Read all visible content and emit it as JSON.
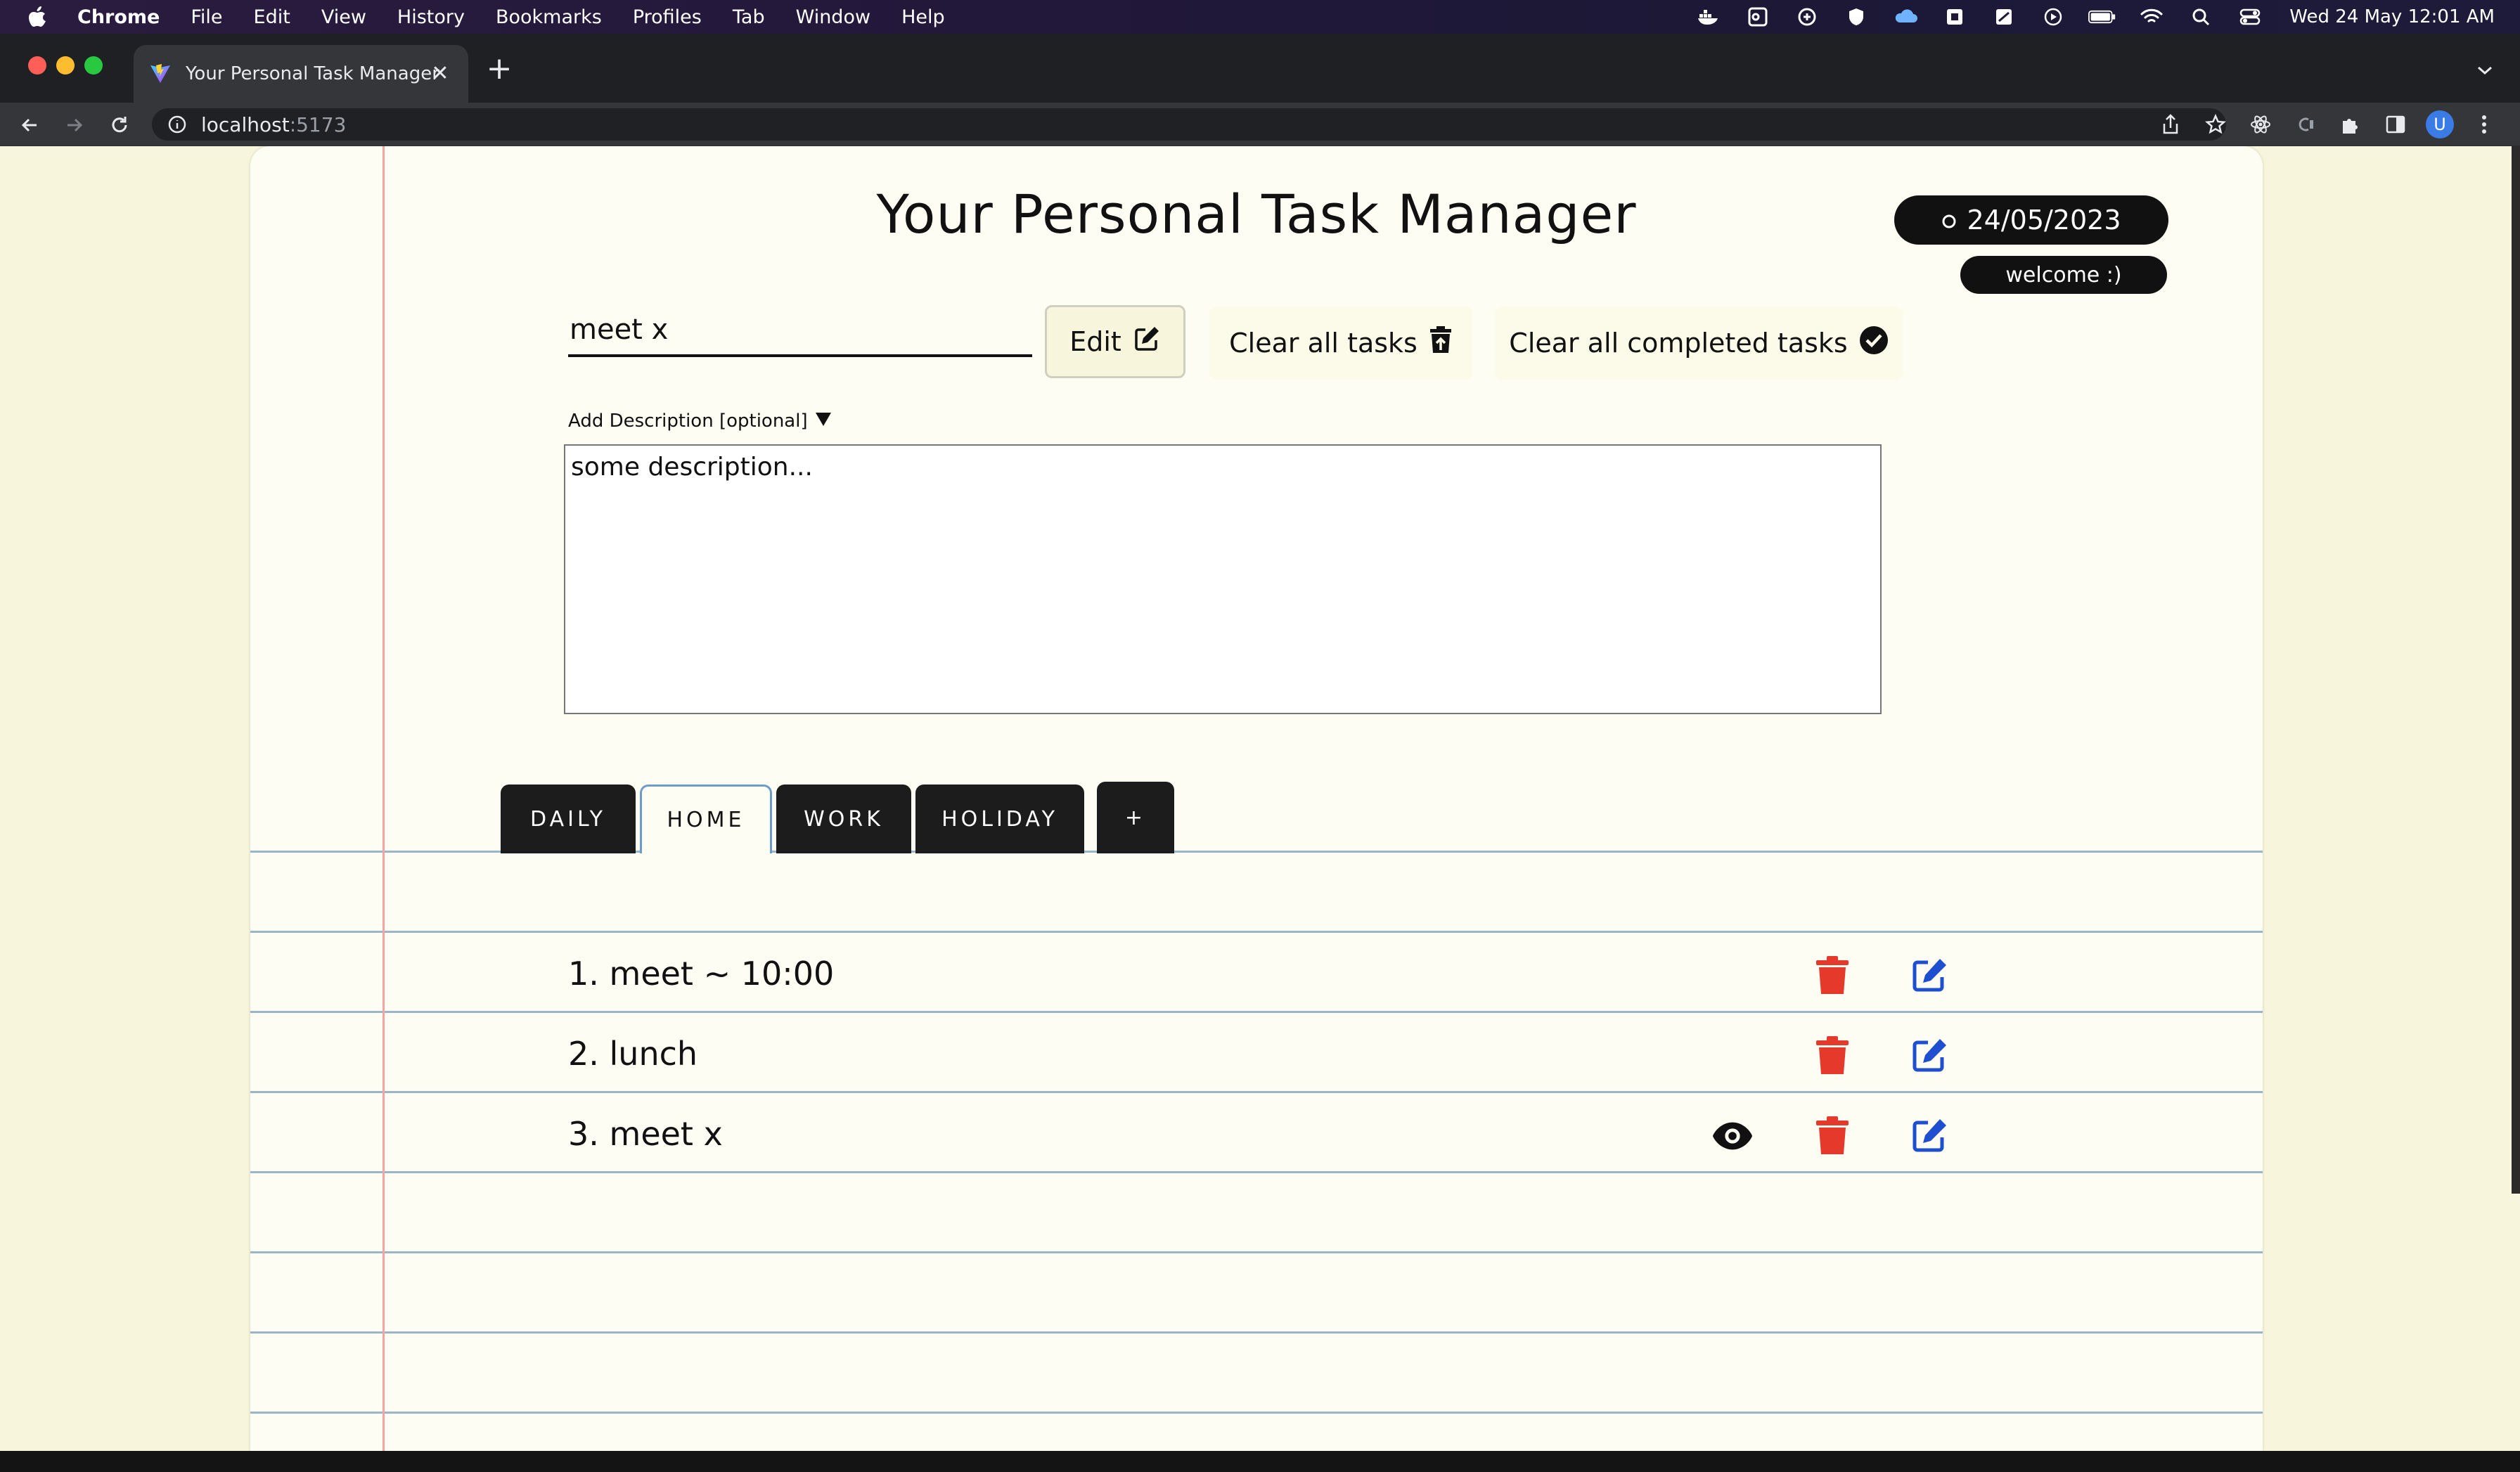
{
  "menubar": {
    "app_name": "Chrome",
    "items": [
      "File",
      "Edit",
      "View",
      "History",
      "Bookmarks",
      "Profiles",
      "Tab",
      "Window",
      "Help"
    ],
    "clock": "Wed 24 May  12:01 AM"
  },
  "browser": {
    "tab_title": "Your Personal Task Manager",
    "new_tab_symbol": "+",
    "close_symbol": "✕",
    "url_host": "localhost",
    "url_port": ":5173",
    "profile_initial": "U"
  },
  "app": {
    "title": "Your Personal Task Manager",
    "date": "24/05/2023",
    "welcome": "welcome :)",
    "input_value": "meet x",
    "edit_label": "Edit",
    "clear_all_label": "Clear all tasks",
    "clear_completed_label": "Clear all completed tasks",
    "description_toggle": "Add Description [optional]",
    "description_value": "some description...",
    "tabs": [
      {
        "label": "DAILY",
        "active": false
      },
      {
        "label": "HOME",
        "active": true
      },
      {
        "label": "WORK",
        "active": false
      },
      {
        "label": "HOLIDAY",
        "active": false
      },
      {
        "label": "+",
        "active": false
      }
    ],
    "tasks": [
      {
        "text": "1. meet ~ 10:00",
        "has_description": false
      },
      {
        "text": "2. lunch",
        "has_description": false
      },
      {
        "text": "3. meet x",
        "has_description": true
      }
    ]
  },
  "colors": {
    "page_bg": "#f7f6dc",
    "sheet_bg": "#fdfdf4",
    "margin_line": "#f5a3a3",
    "rule_line": "#9ab4c8",
    "delete_icon": "#e53a2b",
    "edit_icon": "#1f4fd1",
    "pill_bg": "#111111"
  }
}
